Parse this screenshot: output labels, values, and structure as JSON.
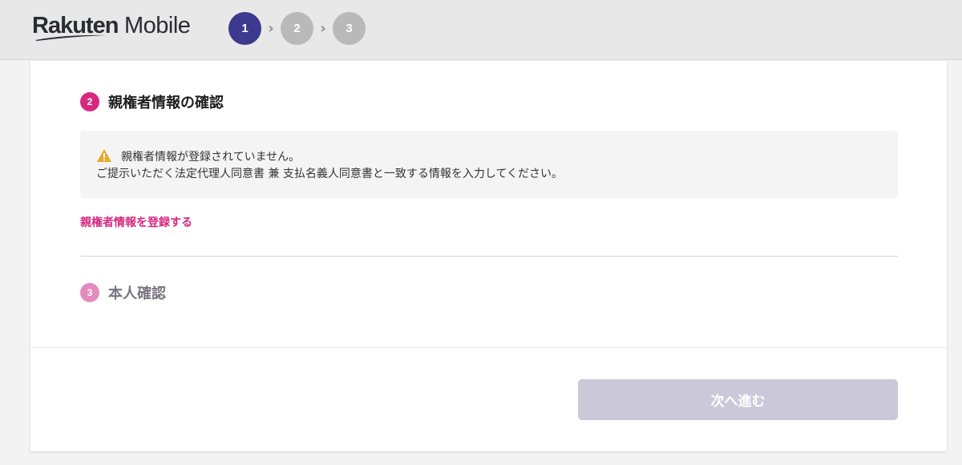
{
  "header": {
    "logo": {
      "brand": "Rakuten",
      "product": " Mobile"
    },
    "steps": [
      {
        "label": "1",
        "state": "active"
      },
      {
        "label": "2",
        "state": "inactive"
      },
      {
        "label": "3",
        "state": "inactive"
      }
    ],
    "step_separator": "›"
  },
  "sections": {
    "guardian": {
      "number": "2",
      "title": "親権者情報の確認",
      "notice": {
        "icon": "warning-icon",
        "line1": "親権者情報が登録されていません。",
        "line2": "ご提示いただく法定代理人同意書 兼 支払名義人同意書と一致する情報を入力してください。"
      },
      "register_link": "親権者情報を登録する"
    },
    "identity": {
      "number": "3",
      "title": "本人確認"
    }
  },
  "footer": {
    "next_button": "次へ進む"
  },
  "colors": {
    "active_step": "#3c3a8f",
    "inactive_step": "#b9b9b9",
    "accent_pink": "#d6287f",
    "light_pink": "#e48bbd",
    "warning": "#e8a92a",
    "disabled_button": "#cbc9d9"
  }
}
